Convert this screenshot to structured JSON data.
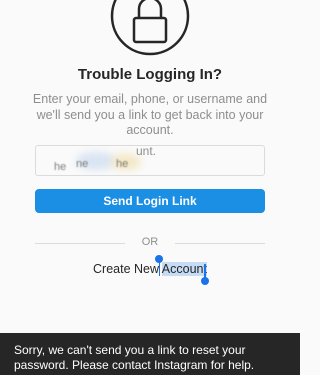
{
  "header": {
    "title": "Trouble Logging In?",
    "description": "Enter your email, phone, or username and we'll send you a link to get back into your account."
  },
  "form": {
    "input_visible_fragment": "unt.",
    "input_blurred_fragments": [
      "he",
      "ne",
      "he"
    ],
    "send_button_label": "Send Login Link"
  },
  "divider": {
    "or_label": "OR"
  },
  "create_account": {
    "prefix": "Create New ",
    "selected": "Account"
  },
  "toast": {
    "message": "Sorry, we can't send you a link to reset your password. Please contact Instagram for help."
  },
  "colors": {
    "accent": "#1a8fe3",
    "selection": "#c6dcf5",
    "handle": "#1a73e8",
    "toast_bg": "#262626"
  },
  "icons": [
    "lock-icon"
  ]
}
